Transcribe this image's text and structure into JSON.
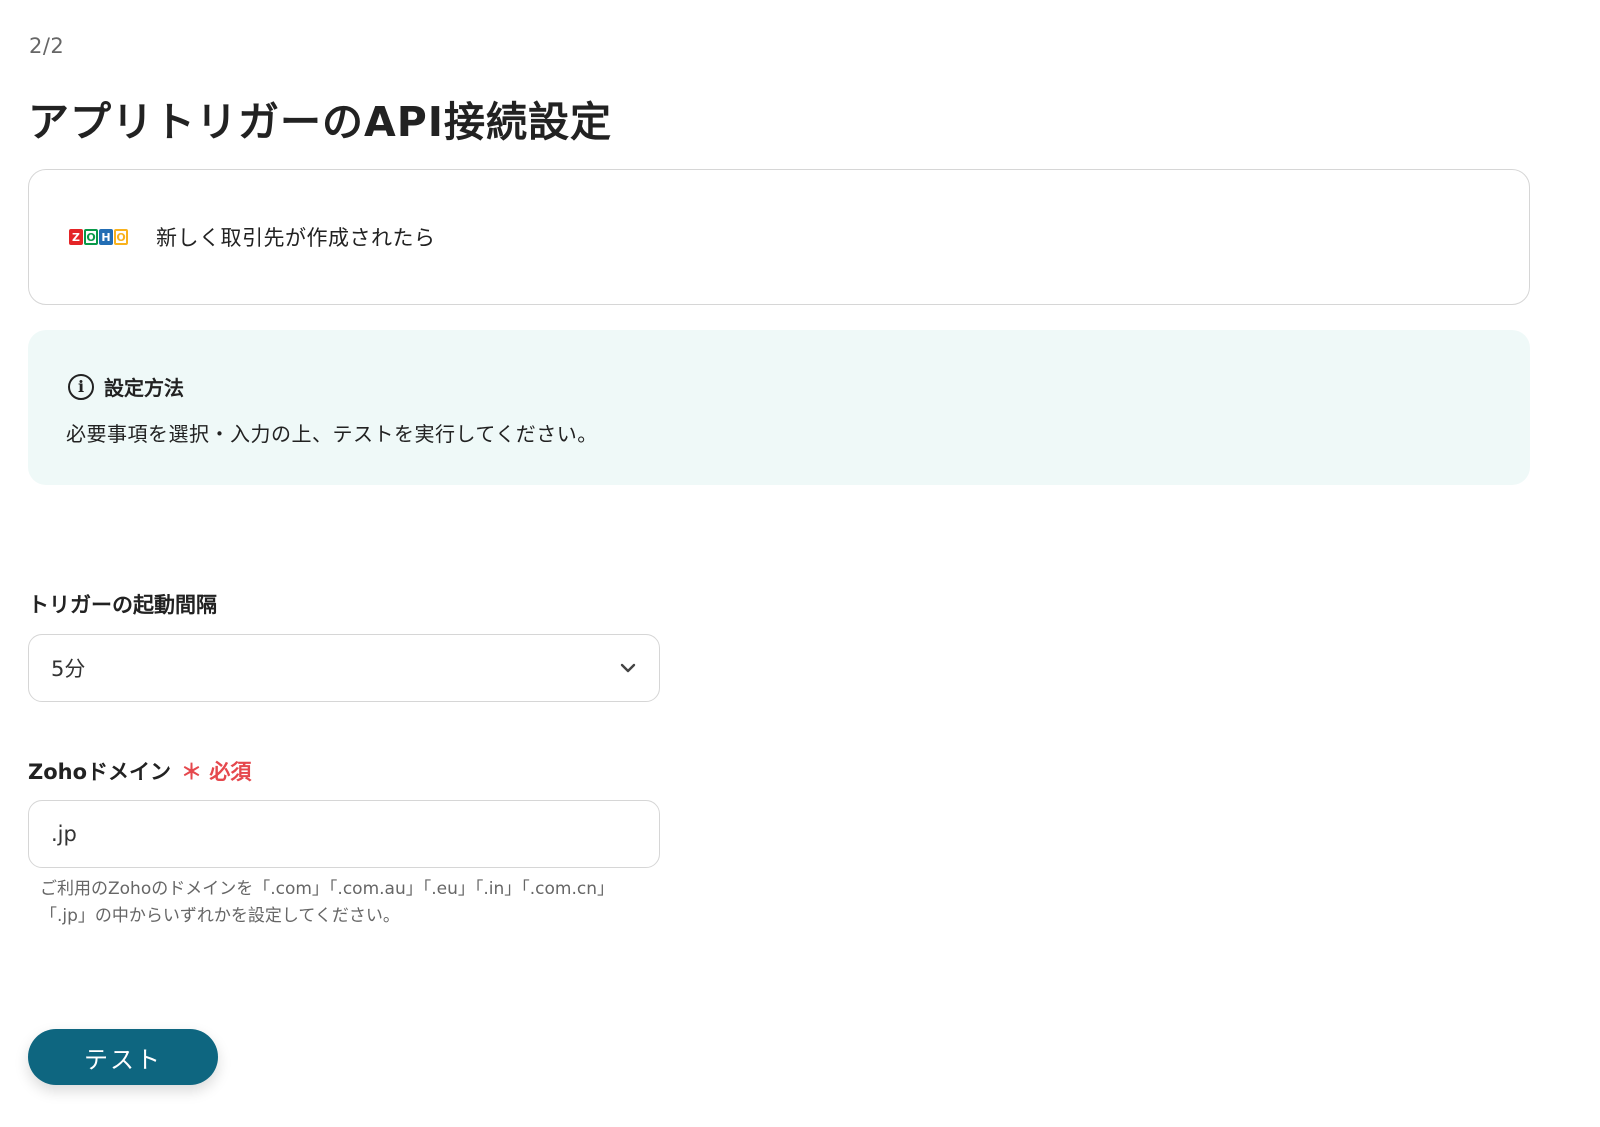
{
  "step": "2/2",
  "page_title": "アプリトリガーのAPI接続設定",
  "trigger": {
    "logo_letters": [
      "Z",
      "O",
      "H",
      "O"
    ],
    "logo_colors": [
      "#e42527",
      "#089949",
      "#226db4",
      "#f9b21d"
    ],
    "label": "新しく取引先が作成されたら"
  },
  "info": {
    "icon": "info-icon",
    "title": "設定方法",
    "body": "必要事項を選択・入力の上、テストを実行してください。"
  },
  "interval_field": {
    "label": "トリガーの起動間隔",
    "value": "5分"
  },
  "domain_field": {
    "label": "Zohoドメイン",
    "required_label": "＊ 必須",
    "value": ".jp",
    "help_line1": "ご利用のZohoのドメインを「.com」「.com.au」「.eu」「.in」「.com.cn」",
    "help_line2": "「.jp」の中からいずれかを設定してください。"
  },
  "test_button_label": "テスト",
  "colors": {
    "accent": "#0e6680",
    "required": "#e5484d",
    "info_bg": "#eff9f8"
  }
}
